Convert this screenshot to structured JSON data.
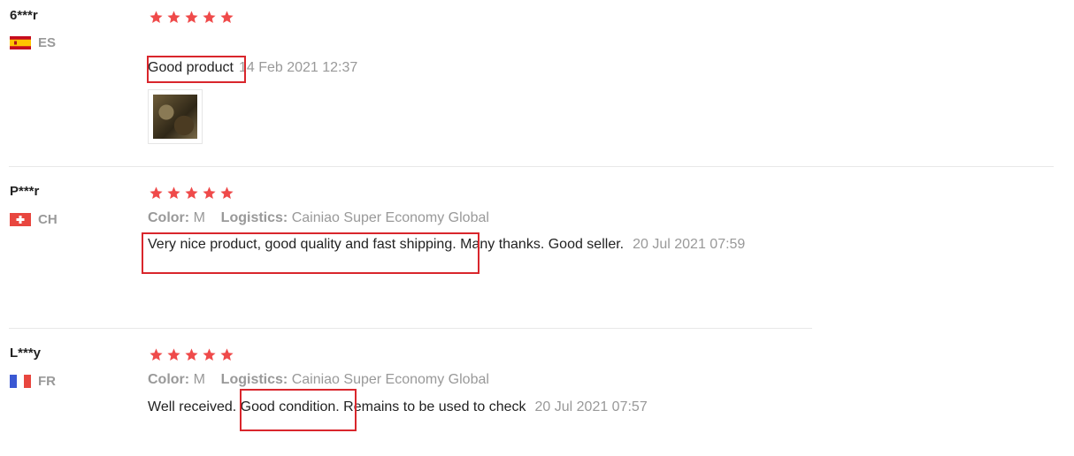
{
  "reviews": [
    {
      "user": "6***r",
      "country": "ES",
      "rating": 5,
      "text_highlight": "Good product",
      "text_rest": "",
      "date": "14 Feb 2021 12:37",
      "has_photo": true
    },
    {
      "user": "P***r",
      "country": "CH",
      "rating": 5,
      "color_label": "Color:",
      "color_value": "M",
      "logistics_label": "Logistics:",
      "logistics_value": "Cainiao Super Economy Global",
      "text_highlight": "Very nice product, good quality and fast shipping.",
      "text_rest": " Many thanks. Good seller.",
      "date": "20 Jul 2021 07:59"
    },
    {
      "user": "L***y",
      "country": "FR",
      "rating": 5,
      "color_label": "Color:",
      "color_value": "M",
      "logistics_label": "Logistics:",
      "logistics_value": "Cainiao Super Economy Global",
      "text_before": "Well received. ",
      "text_highlight": "Good condition.",
      "text_rest": " Remains to be used to check",
      "date": "20 Jul 2021 07:57"
    }
  ],
  "colors": {
    "star": "#ef4a4a",
    "highlight_box": "#d9262c"
  }
}
